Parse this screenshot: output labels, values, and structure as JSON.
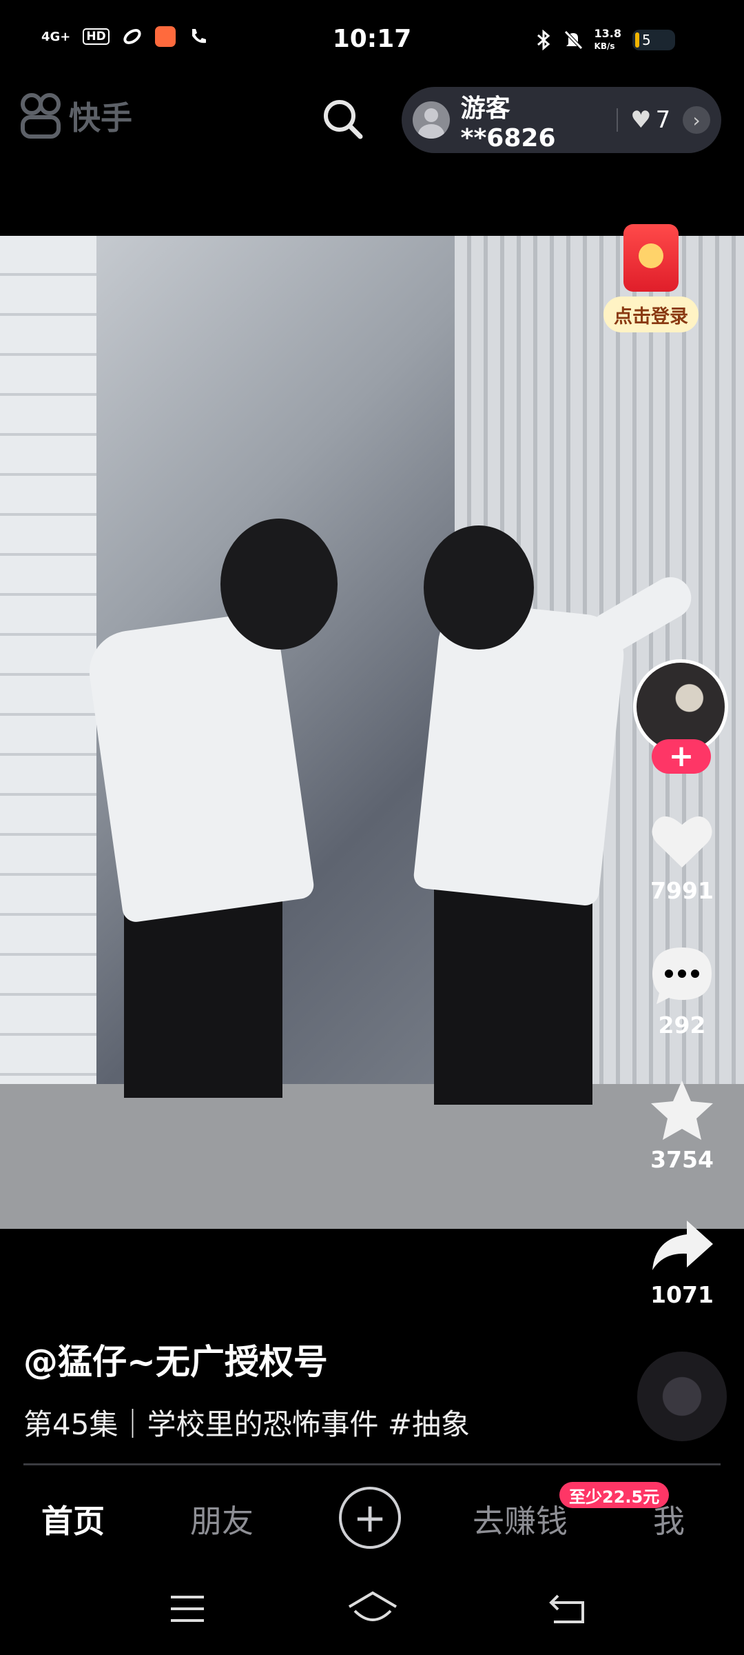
{
  "status_bar": {
    "network": "4G+",
    "hd": "HD",
    "time": "10:17",
    "speed_value": "13.8",
    "speed_unit": "KB/s",
    "battery": "5"
  },
  "header": {
    "logo_text": "快手",
    "user_name": "游客**6826",
    "like_count": "7"
  },
  "side_actions": {
    "login_label": "点击登录",
    "likes": "7991",
    "comments": "292",
    "favorites": "3754",
    "shares": "1071"
  },
  "caption": {
    "author": "@猛仔~无广授权号",
    "description": "第45集｜学校里的恐怖事件 #抽象"
  },
  "bottom_nav": {
    "home": "首页",
    "friends": "朋友",
    "earn": "去赚钱",
    "earn_badge": "至少22.5元",
    "me": "我"
  },
  "colors": {
    "accent": "#fe3666",
    "background": "#000000",
    "pill": "#2b2d36"
  }
}
